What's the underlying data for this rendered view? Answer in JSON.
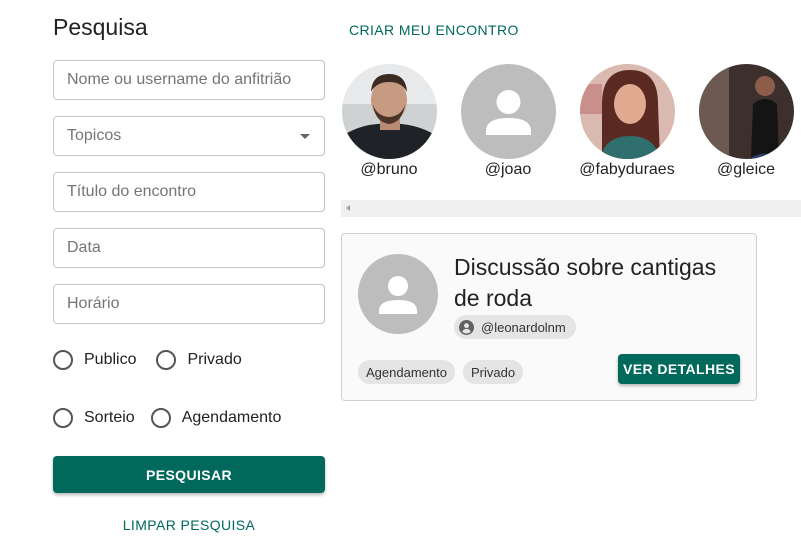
{
  "search": {
    "title": "Pesquisa",
    "host_placeholder": "Nome ou username do anfitrião",
    "topics_placeholder": "Topicos",
    "meeting_title_placeholder": "Título do encontro",
    "date_placeholder": "Data",
    "time_placeholder": "Horário",
    "radio_public": "Publico",
    "radio_private": "Privado",
    "radio_raffle": "Sorteio",
    "radio_scheduling": "Agendamento",
    "search_button": "PESQUISAR",
    "clear_button": "LIMPAR PESQUISA"
  },
  "header": {
    "create_link": "CRIAR MEU ENCONTRO"
  },
  "hosts": [
    {
      "username": "@bruno"
    },
    {
      "username": "@joao"
    },
    {
      "username": "@fabyduraes"
    },
    {
      "username": "@gleice"
    }
  ],
  "meeting_card": {
    "title": "Discussão sobre cantigas de roda",
    "host": "@leonardolnm",
    "tags": [
      "Agendamento",
      "Privado"
    ],
    "details_button": "VER DETALHES"
  },
  "colors": {
    "primary": "#00695c",
    "placeholder_avatar": "#bdbdbd",
    "chip": "#e4e4e4"
  }
}
